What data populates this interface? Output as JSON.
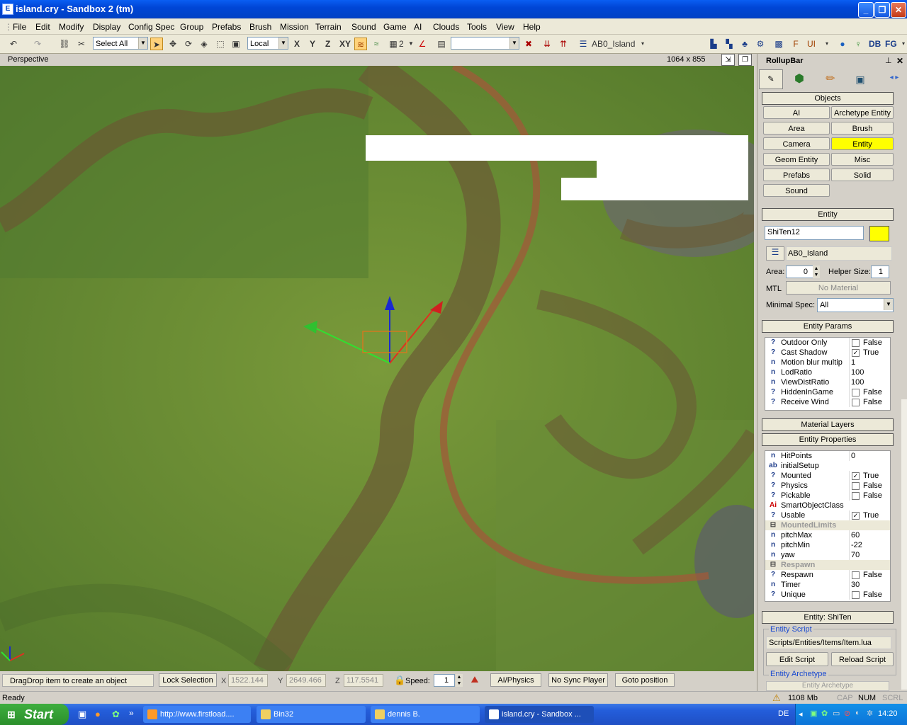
{
  "window": {
    "title": "island.cry - Sandbox 2 (tm)"
  },
  "menu": [
    "File",
    "Edit",
    "Modify",
    "Display",
    "Config Spec",
    "Group",
    "Prefabs",
    "Brush",
    "Mission",
    "Terrain",
    "Sound",
    "Game",
    "AI",
    "Clouds",
    "Tools",
    "View",
    "Help"
  ],
  "toolbar": {
    "select_filter": "Select All",
    "coord_system": "Local",
    "axis_x": "X",
    "axis_y": "Y",
    "axis_z": "Z",
    "axis_xy": "XY",
    "grid_size": "2",
    "layer": "AB0_Island",
    "db": "DB",
    "fg": "FG"
  },
  "viewport": {
    "label": "Perspective",
    "resolution": "1064 x 855"
  },
  "rollup": {
    "title": "RollupBar",
    "objects_header": "Objects",
    "object_buttons": [
      {
        "label": "AI"
      },
      {
        "label": "Archetype Entity"
      },
      {
        "label": "Area"
      },
      {
        "label": "Brush"
      },
      {
        "label": "Camera"
      },
      {
        "label": "Entity"
      },
      {
        "label": "Geom Entity"
      },
      {
        "label": "Misc"
      },
      {
        "label": "Prefabs"
      },
      {
        "label": "Solid"
      },
      {
        "label": "Sound"
      }
    ],
    "selected_button": "Entity",
    "selected_color": "#ffff00",
    "entity_header": "Entity",
    "entity_name": "ShiTen12",
    "entity_color": "#ffff00",
    "entity_layer": "AB0_Island",
    "area_label": "Area:",
    "area_value": "0",
    "helper_label": "Helper Size:",
    "helper_value": "1",
    "mtl_label": "MTL",
    "mtl_value": "No Material",
    "minspec_label": "Minimal Spec:",
    "minspec_value": "All",
    "params_header": "Entity Params",
    "params": [
      {
        "icon": "?",
        "name": "Outdoor Only",
        "value": "False",
        "check": " "
      },
      {
        "icon": "?",
        "name": "Cast Shadow",
        "value": "True",
        "check": "✓"
      },
      {
        "icon": "n",
        "name": "Motion blur multip",
        "value": "1"
      },
      {
        "icon": "n",
        "name": "LodRatio",
        "value": "100"
      },
      {
        "icon": "n",
        "name": "ViewDistRatio",
        "value": "100"
      },
      {
        "icon": "?",
        "name": "HiddenInGame",
        "value": "False",
        "check": " "
      },
      {
        "icon": "?",
        "name": "Receive Wind",
        "value": "False",
        "check": " "
      }
    ],
    "material_layers": "Material Layers",
    "props_header": "Entity Properties",
    "props": [
      {
        "icon": "n",
        "name": "HitPoints",
        "value": "0"
      },
      {
        "icon": "ab",
        "name": "initialSetup",
        "value": ""
      },
      {
        "icon": "?",
        "name": "Mounted",
        "value": "True",
        "check": "✓"
      },
      {
        "icon": "?",
        "name": "Physics",
        "value": "False",
        "check": " "
      },
      {
        "icon": "?",
        "name": "Pickable",
        "value": "False",
        "check": " "
      },
      {
        "icon": "Ai",
        "name": "SmartObjectClass",
        "value": ""
      },
      {
        "icon": "?",
        "name": "Usable",
        "value": "True",
        "check": "✓"
      },
      {
        "icon": "⊟",
        "name": "MountedLimits",
        "group": true
      },
      {
        "icon": "n",
        "name": "pitchMax",
        "value": "60"
      },
      {
        "icon": "n",
        "name": "pitchMin",
        "value": "-22"
      },
      {
        "icon": "n",
        "name": "yaw",
        "value": "70"
      },
      {
        "icon": "⊟",
        "name": "Respawn",
        "group": true
      },
      {
        "icon": "?",
        "name": "Respawn",
        "value": "False",
        "check": " "
      },
      {
        "icon": "n",
        "name": "Timer",
        "value": "30"
      },
      {
        "icon": "?",
        "name": "Unique",
        "value": "False",
        "check": " "
      }
    ],
    "entity_type_header": "Entity: ShiTen",
    "entity_script_label": "Entity Script",
    "entity_script_path": "Scripts/Entities/Items/Item.lua",
    "edit_script": "Edit Script",
    "reload_script": "Reload Script",
    "entity_archetype_label": "Entity Archetype",
    "entity_archetype_value": "Entity Archetype"
  },
  "statusbar": {
    "hint": "DragDrop item to create an object",
    "lock_selection": "Lock Selection",
    "x_label": "X",
    "x_value": "1522.144",
    "y_label": "Y",
    "y_value": "2649.466",
    "z_label": "Z",
    "z_value": "117.5541",
    "speed_label": "Speed:",
    "speed_value": "1",
    "ai_physics": "AI/Physics",
    "no_sync": "No Sync Player",
    "goto_position": "Goto position",
    "ready": "Ready",
    "memory": "1108 Mb",
    "cap": "CAP",
    "num": "NUM",
    "scrl": "SCRL"
  },
  "taskbar": {
    "start": "Start",
    "tasks": [
      {
        "label": "http://www.firstload...."
      },
      {
        "label": "Bin32"
      },
      {
        "label": "dennis B."
      },
      {
        "label": "island.cry - Sandbox ..."
      }
    ],
    "lang": "DE",
    "clock": "14:20"
  }
}
